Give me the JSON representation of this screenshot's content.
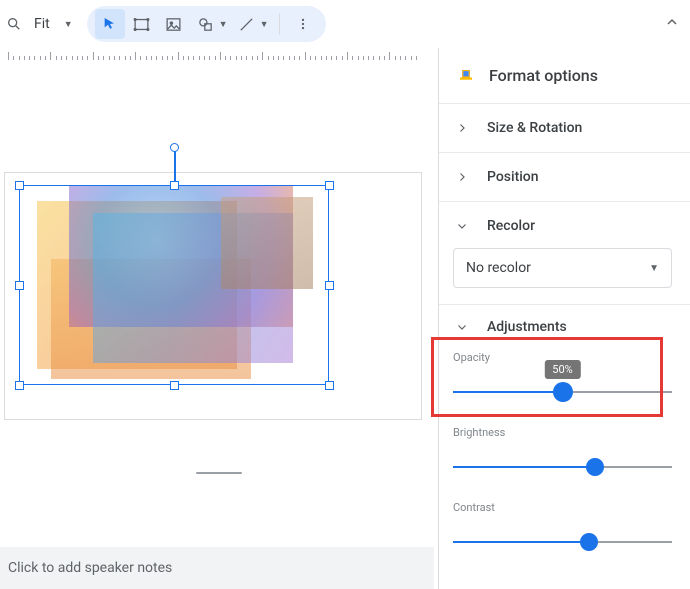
{
  "toolbar": {
    "zoom_label": "Fit"
  },
  "ruler": {},
  "canvas": {
    "notes_placeholder": "Click to add speaker notes"
  },
  "side": {
    "title": "Format options",
    "sections": {
      "size_rotation": "Size & Rotation",
      "position": "Position",
      "recolor": "Recolor",
      "recolor_value": "No recolor",
      "adjustments": "Adjustments"
    },
    "adjust": {
      "opacity_label": "Opacity",
      "opacity_value": "50%",
      "opacity_pct": 50,
      "brightness_label": "Brightness",
      "brightness_pct": 65,
      "contrast_label": "Contrast",
      "contrast_pct": 62
    }
  }
}
